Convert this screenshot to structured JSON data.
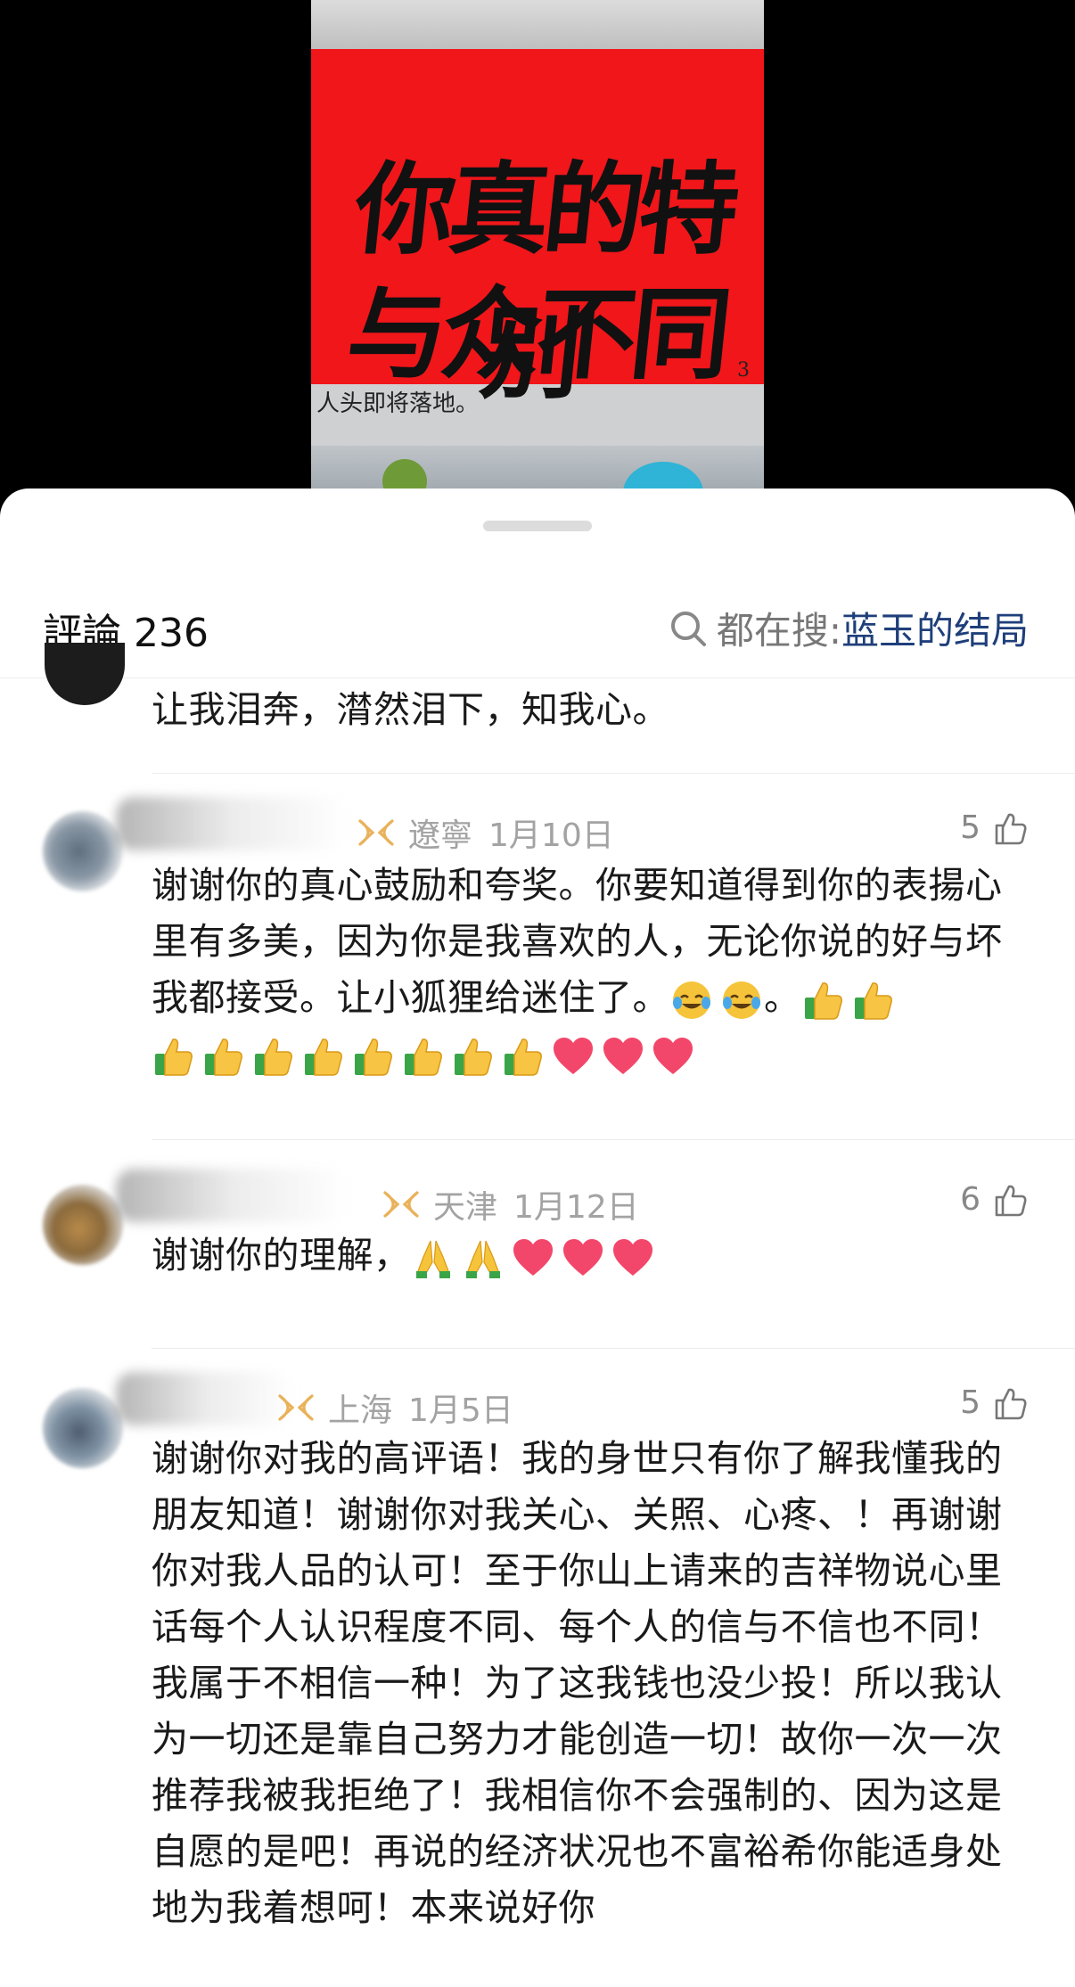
{
  "media": {
    "top_text": "",
    "calligraphy_line1": "你真的特别",
    "calligraphy_line2": "与众不同",
    "page_number": "3",
    "caption": "人头即将落地。"
  },
  "header": {
    "comments_label": "評論",
    "comments_count": "236",
    "search_prefix": "都在搜:",
    "search_term": "蓝玉的结局"
  },
  "comments": [
    {
      "body": "让我泪奔，潸然泪下，知我心。"
    },
    {
      "location": "遼寧",
      "date": "1月10日",
      "likes": "5",
      "body": "谢谢你的真心鼓励和夸奖。你要知道得到你的表揚心里有多美，因为你是我喜欢的人，无论你说的好与坏我都接受。让小狐狸给迷住了。",
      "body_suffix": "。"
    },
    {
      "location": "天津",
      "date": "1月12日",
      "likes": "6",
      "body": "谢谢你的理解，"
    },
    {
      "location": "上海",
      "date": "1月5日",
      "likes": "5",
      "body": "谢谢你对我的高评语！我的身世只有你了解我懂我的朋友知道！谢谢你对我关心、关照、心疼、！再谢谢你对我人品的认可！至于你山上请来的吉祥物说心里话每个人认识程度不同、每个人的信与不信也不同！我属于不相信一种！为了这我钱也没少投！所以我认为一切还是靠自己努力才能创造一切！故你一次一次推荐我被我拒绝了！我相信你不会强制的、因为这是自愿的是吧！再说的经济状况也不富裕希你能适身处地为我着想呵！本来说好你"
    }
  ],
  "icons": {
    "search": "search-icon",
    "vip": "vip-badge-icon",
    "thumb": "thumbs-up-outline-icon"
  },
  "colors": {
    "accent_blue": "#1f3f7a",
    "meta_gray": "#a3a3a3",
    "banner_red": "#f0161a",
    "vip_gold": "#e9b25a"
  }
}
